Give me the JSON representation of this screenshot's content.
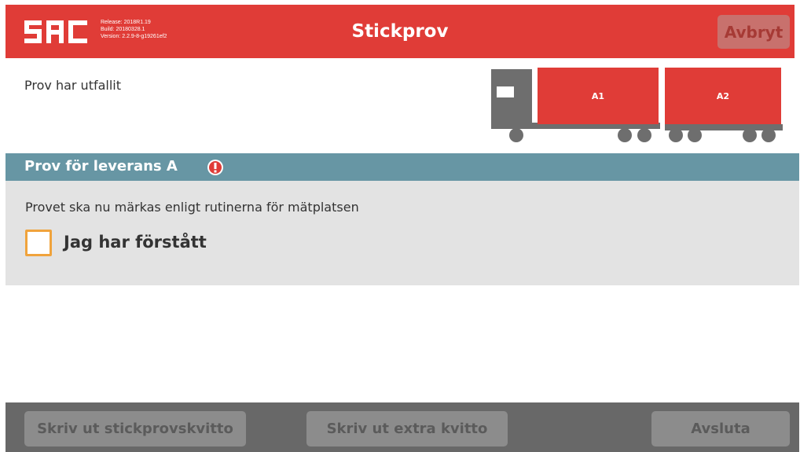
{
  "header": {
    "logo_text": "SDC",
    "version": {
      "release": "Release: 2018R1.19",
      "build": "Build: 20180328.1",
      "version": "Version: 2.2.9-8-g19261ef2"
    },
    "title": "Stickprov",
    "cancel_label": "Avbryt"
  },
  "status": {
    "text": "Prov har utfallit"
  },
  "vehicle": {
    "units": [
      {
        "label": "A1",
        "color": "#e03c37"
      },
      {
        "label": "A2",
        "color": "#e03c37"
      }
    ],
    "cab_color": "#6e6e6e"
  },
  "section": {
    "title": "Prov för leverans A",
    "warning_icon": "exclamation-circle-icon",
    "instruction": "Provet ska nu märkas enligt rutinerna för mätplatsen",
    "checkbox_label": "Jag har förstått",
    "checkbox_checked": false
  },
  "footer": {
    "print_receipt_label": "Skriv ut stickprovskvitto",
    "print_extra_label": "Skriv ut extra kvitto",
    "finish_label": "Avsluta"
  },
  "colors": {
    "header_red": "#e03c37",
    "section_blue": "#6796a4",
    "checkbox_orange": "#f0a33c",
    "footer_gray": "#686868"
  }
}
